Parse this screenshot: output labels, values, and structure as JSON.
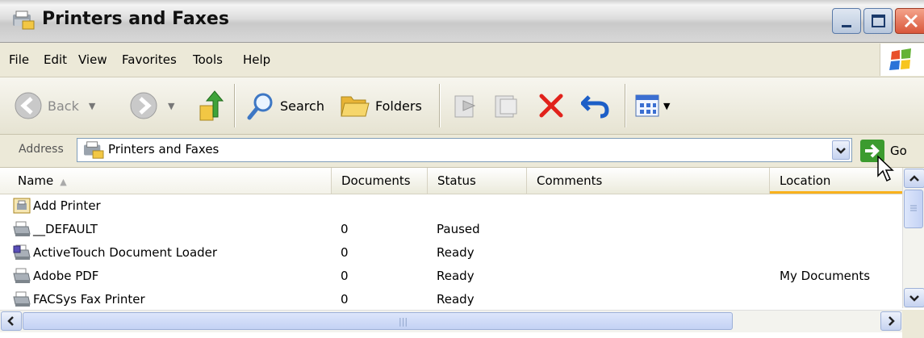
{
  "window": {
    "title": "Printers and Faxes"
  },
  "menu": [
    "File",
    "Edit",
    "View",
    "Favorites",
    "Tools",
    "Help"
  ],
  "toolbar": {
    "back_label": "Back",
    "search_label": "Search",
    "folders_label": "Folders"
  },
  "address": {
    "label": "Address",
    "value": "Printers and Faxes",
    "go_label": "Go"
  },
  "columns": {
    "name": "Name",
    "documents": "Documents",
    "status": "Status",
    "comments": "Comments",
    "location": "Location"
  },
  "rows": [
    {
      "name": "Add Printer",
      "documents": "",
      "status": "",
      "comments": "",
      "location": "",
      "icon": "add-printer-icon"
    },
    {
      "name": "__DEFAULT",
      "documents": "0",
      "status": "Paused",
      "comments": "",
      "location": "",
      "icon": "printer-icon"
    },
    {
      "name": "ActiveTouch Document Loader",
      "documents": "0",
      "status": "Ready",
      "comments": "",
      "location": "",
      "icon": "network-printer-icon"
    },
    {
      "name": "Adobe PDF",
      "documents": "0",
      "status": "Ready",
      "comments": "",
      "location": "My Documents",
      "icon": "printer-icon"
    },
    {
      "name": "FACSys Fax Printer",
      "documents": "0",
      "status": "Ready",
      "comments": "",
      "location": "",
      "icon": "printer-icon"
    }
  ],
  "colors": {
    "title_bar": "#d6d6d6",
    "go_button": "#3c9b2f",
    "close_button": "#d9573a",
    "sort_highlight": "#f9b11c"
  }
}
